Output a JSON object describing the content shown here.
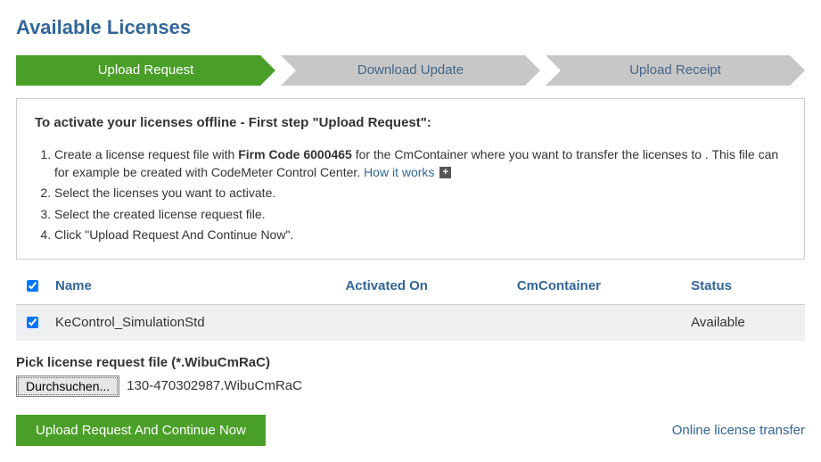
{
  "title": "Available Licenses",
  "stepper": {
    "steps": [
      "Upload Request",
      "Download Update",
      "Upload Receipt"
    ],
    "active": 0
  },
  "instructions": {
    "heading": "To activate your licenses offline - First step \"Upload Request\":",
    "step1_pre": "Create a license request file with ",
    "step1_bold": "Firm Code 6000465",
    "step1_post": " for the CmContainer where you want to transfer the licenses to . This file can for example be created with CodeMeter Control Center. ",
    "step1_link": "How it works",
    "step2": "Select the licenses you want to activate.",
    "step3": "Select the created license request file.",
    "step4": "Click \"Upload Request And Continue Now\"."
  },
  "table": {
    "headers": {
      "name": "Name",
      "activated_on": "Activated On",
      "cmcontainer": "CmContainer",
      "status": "Status"
    },
    "rows": [
      {
        "name": "KeControl_SimulationStd",
        "activated_on": "",
        "cmcontainer": "",
        "status": "Available",
        "checked": true
      }
    ]
  },
  "file_picker": {
    "label": "Pick license request file (*.WibuCmRaC)",
    "browse_label": "Durchsuchen...",
    "selected": "130-470302987.WibuCmRaC"
  },
  "buttons": {
    "upload": "Upload Request And Continue Now",
    "online_link": "Online license transfer"
  }
}
